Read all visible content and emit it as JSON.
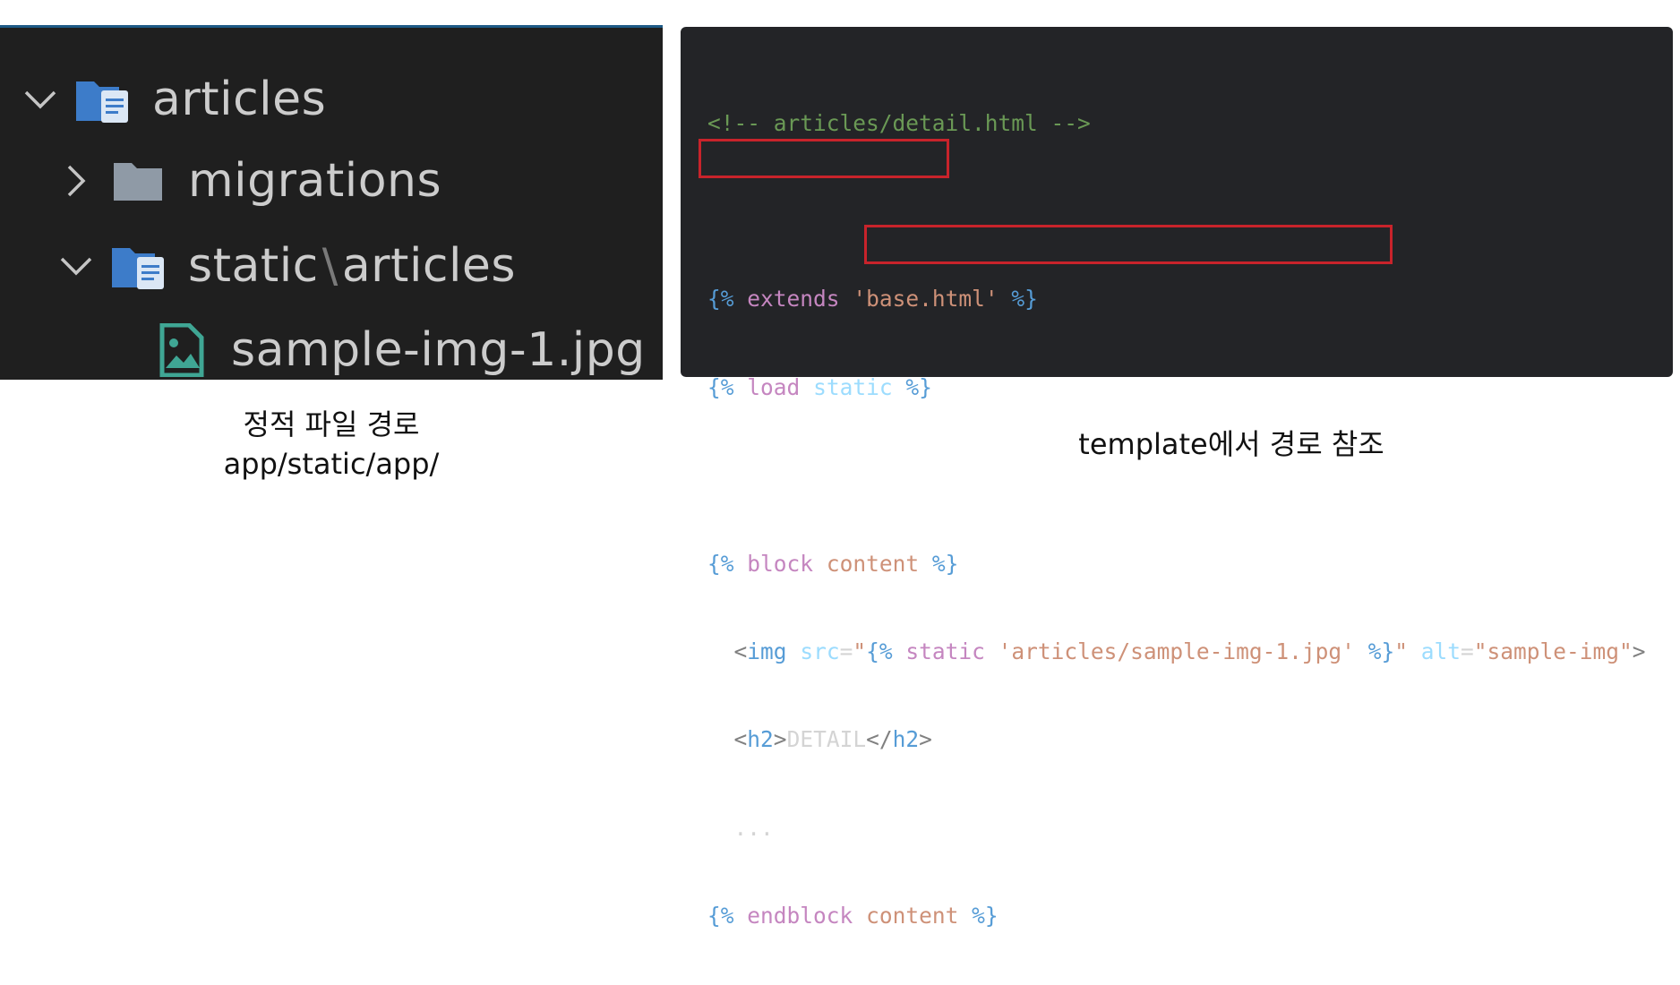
{
  "explorer": {
    "items": [
      {
        "label": "articles",
        "icon": "folder-doc-icon",
        "chevron": "chevron-down-icon"
      },
      {
        "label": "migrations",
        "icon": "folder-icon",
        "chevron": "chevron-right-icon"
      },
      {
        "label_a": "static",
        "separator": "\\",
        "label_b": "articles",
        "icon": "folder-doc-icon",
        "chevron": "chevron-down-icon"
      },
      {
        "label": "sample-img-1.jpg",
        "icon": "image-file-icon"
      }
    ]
  },
  "code": {
    "line1": "<!-- articles/detail.html -->",
    "l3_open": "{%",
    "l3_kw": "extends",
    "l3_str": "'base.html'",
    "l3_close": "%}",
    "l4_open": "{%",
    "l4_kw": "load",
    "l4_name": "static",
    "l4_close": "%}",
    "l6_open": "{%",
    "l6_kw": "block",
    "l6_name": "content",
    "l6_close": "%}",
    "l7_indent": "  ",
    "l7_lt": "<",
    "l7_tag": "img",
    "l7_attr1": "src",
    "l7_eq1": "=",
    "l7_q1": "\"",
    "l7_open": "{%",
    "l7_kw": "static",
    "l7_str": "'articles/sample-img-1.jpg'",
    "l7_close": "%}",
    "l7_q2": "\"",
    "l7_attr2": "alt",
    "l7_eq2": "=",
    "l7_str2": "\"sample-img\"",
    "l7_gt": ">",
    "l8_lt": "<",
    "l8_tag": "h2",
    "l8_gt": ">",
    "l8_text": "DETAIL",
    "l8_lt2": "</",
    "l8_tag2": "h2",
    "l8_gt2": ">",
    "l9_text": "...",
    "l10_open": "{%",
    "l10_kw": "endblock",
    "l10_name": "content",
    "l10_close": "%}"
  },
  "captions": {
    "left_line1": "정적 파일 경로",
    "left_line2": "app/static/app/",
    "right": "template에서 경로 참조"
  },
  "colors": {
    "highlight_box": "#c8232b",
    "folder_blue": "#3d7cc9",
    "image_file_teal": "#3fa694"
  }
}
